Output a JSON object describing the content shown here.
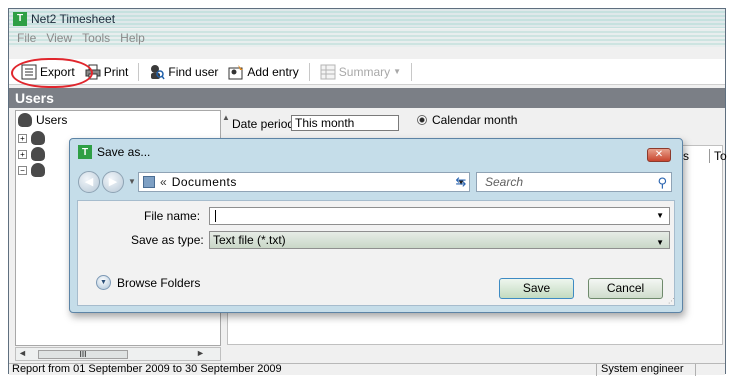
{
  "window": {
    "title": "Net2 Timesheet",
    "logo_letter": "T"
  },
  "menu": {
    "items": [
      "File",
      "View",
      "Tools",
      "Help"
    ]
  },
  "toolbar": {
    "export_label": "Export",
    "print_label": "Print",
    "find_user_label": "Find user",
    "add_entry_label": "Add entry",
    "summary_label": "Summary",
    "summary_arrow": "▼"
  },
  "section": {
    "title": "Users"
  },
  "tree": {
    "root_label": "Users",
    "plus": "+",
    "minus": "−"
  },
  "filters": {
    "date_period_label": "Date period",
    "date_period_value": "This month",
    "calendar_month_label": "Calendar month"
  },
  "grid": {
    "col_partial_s": "s",
    "col_partial_to": "To"
  },
  "scroll": {
    "thumb": "III",
    "left": "◄",
    "right": "►"
  },
  "status": {
    "report_range": "Report from 01 September 2009 to 30 September 2009",
    "role": "System engineer"
  },
  "dialog": {
    "title": "Save as...",
    "logo_letter": "T",
    "close_label": "✕",
    "path_chevron": "«",
    "path_text": "Documents",
    "search_placeholder": "Search",
    "file_name_label": "File name:",
    "file_name_value": "",
    "save_as_type_label": "Save as type:",
    "save_as_type_value": "Text file (*.txt)",
    "browse_label": "Browse Folders",
    "save_label": "Save",
    "cancel_label": "Cancel"
  },
  "colors": {
    "accent_highlight": "#e0262d",
    "section_header_bg": "#7b7f86",
    "dialog_frame": "#c5dde9",
    "logo_green": "#2f9f45"
  }
}
